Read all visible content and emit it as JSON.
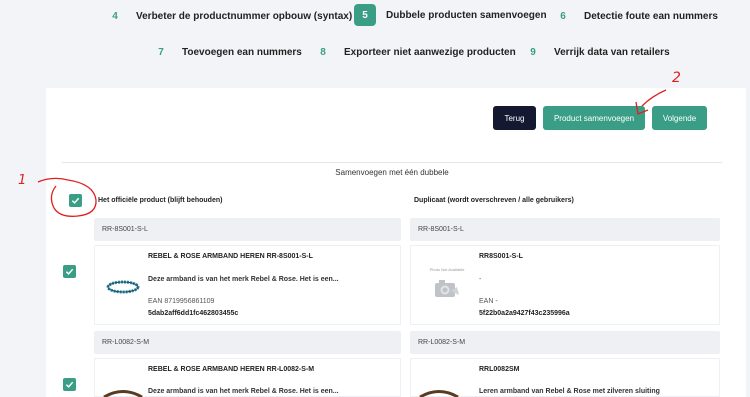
{
  "steps": [
    {
      "num": "4",
      "label": "Verbeter de productnummer opbouw (syntax)"
    },
    {
      "num": "5",
      "label": "Dubbele producten samenvoegen"
    },
    {
      "num": "6",
      "label": "Detectie foute ean nummers"
    },
    {
      "num": "7",
      "label": "Toevoegen ean nummers"
    },
    {
      "num": "8",
      "label": "Exporteer niet aanwezige producten"
    },
    {
      "num": "9",
      "label": "Verrijk data van retailers"
    }
  ],
  "toolbar": {
    "back_label": "Terug",
    "merge_label": "Product samenvoegen",
    "next_label": "Volgende"
  },
  "merge": {
    "title": "Samenvoegen met één dubbele",
    "official_header": "Het officiële product (blijft behouden)",
    "duplicate_header": "Duplicaat (wordt overschreven / alle gebruikers)"
  },
  "rows": [
    {
      "official_sku": "RR-8S001-S-L",
      "duplicate_sku": "RR-8S001-S-L",
      "official": {
        "title": "REBEL & ROSE ARMBAND HEREN RR-8S001-S-L",
        "desc": "Deze armband is van het merk Rebel & Rose. Het is een...",
        "ean": "EAN 8719956861109",
        "id": "5dab2aff6dd1fc462803455c"
      },
      "duplicate": {
        "title": "RR8S001-S-L",
        "desc": "-",
        "ean": "EAN -",
        "id": "5f22b0a2a9427f43c235996a",
        "placeholder_text": "Photo Not Available"
      }
    },
    {
      "official_sku": "RR-L0082-S-M",
      "duplicate_sku": "RR-L0082-S-M",
      "official": {
        "title": "REBEL & ROSE ARMBAND HEREN RR-L0082-S-M",
        "desc": "Deze armband is van het merk Rebel & Rose. Het is een..."
      },
      "duplicate": {
        "title": "RRL0082SM",
        "desc": "Leren armband van Rebel & Rose met zilveren sluiting"
      }
    }
  ],
  "annotations": [
    "1",
    "2"
  ],
  "colors": {
    "accent": "#3a9e86",
    "dark": "#141830",
    "annotation": "#e02020"
  }
}
